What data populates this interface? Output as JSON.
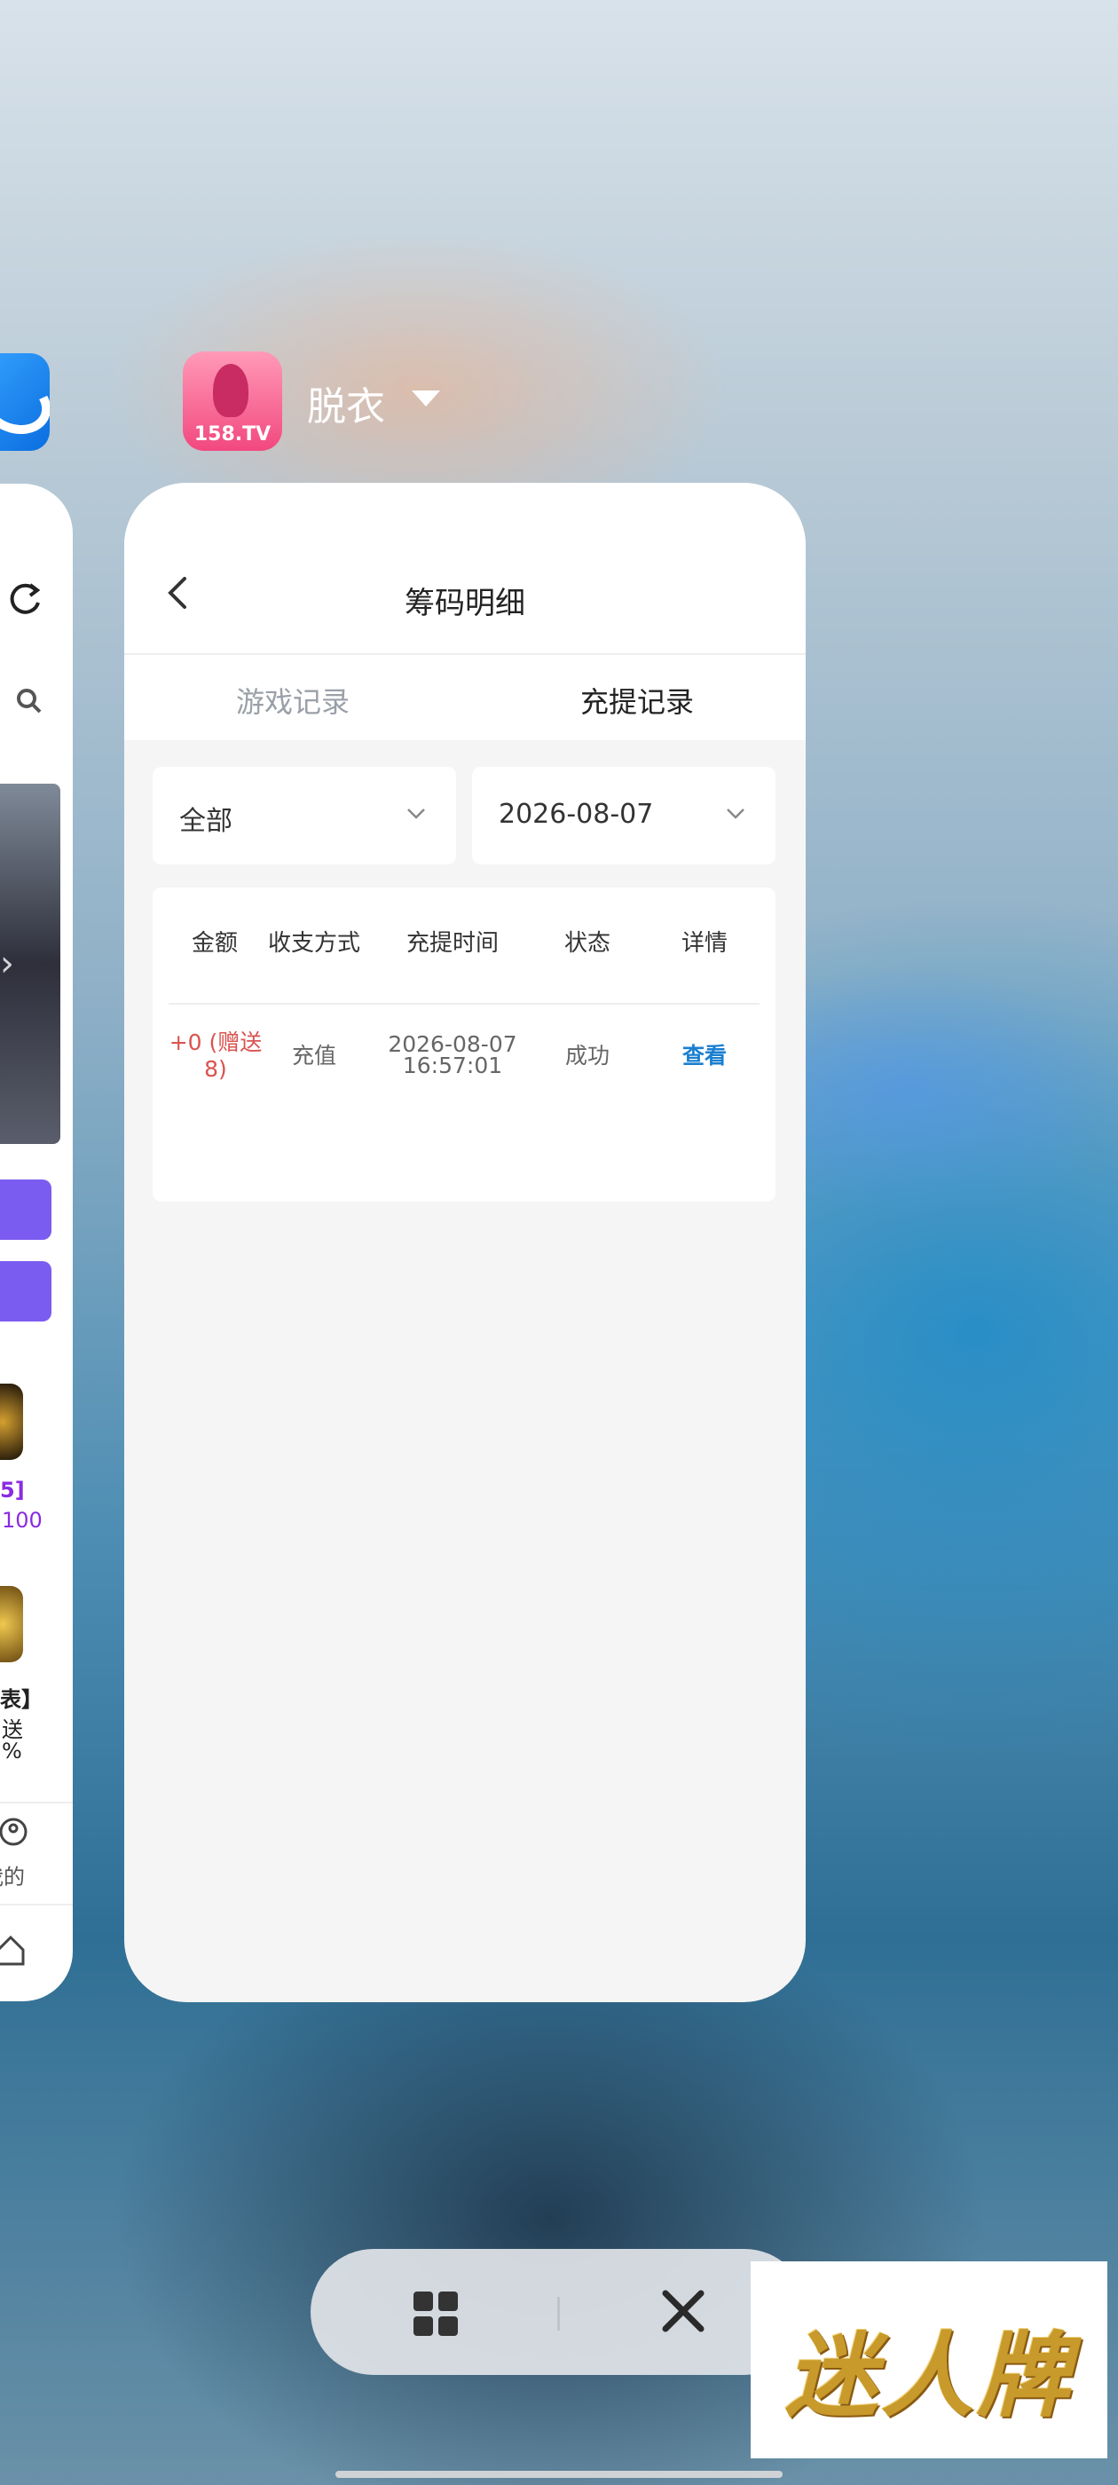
{
  "app": {
    "name": "脱衣",
    "icon_label": "158.TV"
  },
  "page": {
    "title": "筹码明细"
  },
  "tabs": [
    {
      "label": "游戏记录",
      "active": false
    },
    {
      "label": "充提记录",
      "active": true
    }
  ],
  "filters": {
    "type": "全部",
    "date": "2026-08-07"
  },
  "table": {
    "headers": [
      "金额",
      "收支方式",
      "充提时间",
      "状态",
      "详情"
    ],
    "rows": [
      {
        "amount_line1": "+0 (赠送",
        "amount_line2": "8)",
        "method": "充值",
        "time_date": "2026-08-07",
        "time_clock": "16:57:01",
        "status": "成功",
        "detail": "查看"
      }
    ]
  },
  "left_card": {
    "labels": [
      "5]",
      "100",
      "表】",
      "送",
      "%",
      "我的"
    ]
  },
  "brand": {
    "text": "迷人牌"
  },
  "colors": {
    "amount_red": "#d9534f",
    "link_blue": "#1a7fd0",
    "purple": "#7b5cf0",
    "brand_gold": "#c79a2b"
  }
}
